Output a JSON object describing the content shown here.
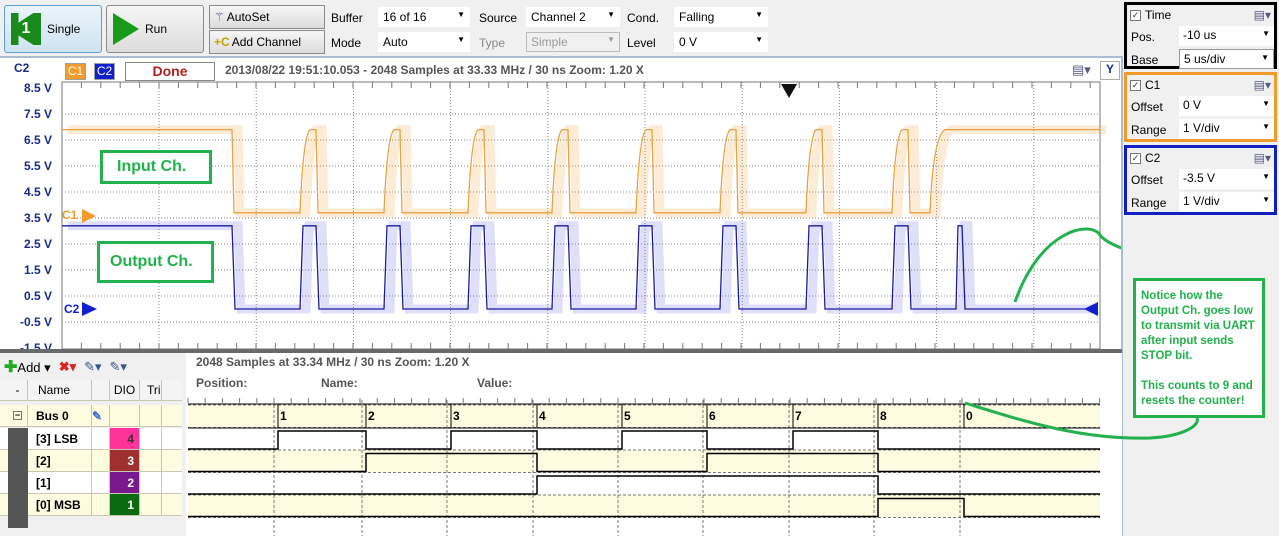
{
  "toolbar": {
    "single_label": "Single",
    "run_label": "Run",
    "autoset_label": "AutoSet",
    "add_channel_label": "Add Channel",
    "buffer_label": "Buffer",
    "buffer_value": "16 of 16",
    "mode_label": "Mode",
    "mode_value": "Auto",
    "source_label": "Source",
    "source_value": "Channel 2",
    "type_label": "Type",
    "type_value": "Simple",
    "cond_label": "Cond.",
    "cond_value": "Falling",
    "level_label": "Level",
    "level_value": "0 V"
  },
  "scope": {
    "active_channel": "C2",
    "badge_c1": "C1",
    "badge_c2": "C2",
    "status": "Done",
    "info": "2013/08/22  19:51:10.053 - 2048 Samples at 33.33 MHz / 30 ns Zoom: 1.20 X",
    "y_button": "Y",
    "y_labels": [
      "8.5 V",
      "7.5 V",
      "6.5 V",
      "5.5 V",
      "4.5 V",
      "3.5 V",
      "2.5 V",
      "1.5 V",
      "0.5 V",
      "-0.5 V",
      "-1.5 V"
    ],
    "c1_marker": "C1",
    "c2_marker": "C2",
    "colors": {
      "c1": "#f0a030",
      "c2": "#1a1aa0",
      "annotation": "#22b14c"
    }
  },
  "annotations": {
    "input": "Input Ch.",
    "output": "Output Ch.",
    "note1": "Notice how the Output Ch. goes low to transmit via UART after input sends STOP bit.",
    "note2": "This counts to 9 and resets the counter!"
  },
  "panels": {
    "time": {
      "title": "Time",
      "pos_label": "Pos.",
      "pos_value": "-10 us",
      "base_label": "Base",
      "base_value": "5 us/div"
    },
    "c1": {
      "title": "C1",
      "offset_label": "Offset",
      "offset_value": "0 V",
      "range_label": "Range",
      "range_value": "1 V/div"
    },
    "c2": {
      "title": "C2",
      "offset_label": "Offset",
      "offset_value": "-3.5 V",
      "range_label": "Range",
      "range_value": "1 V/div"
    }
  },
  "logic": {
    "add_label": "Add",
    "columns": {
      "minus": "-",
      "name": "Name",
      "dio": "DIO",
      "trigger": "Tri"
    },
    "bus": {
      "name": "Bus 0"
    },
    "signals": [
      {
        "name": "[3] LSB",
        "dio": "4",
        "color": "#ff3399"
      },
      {
        "name": "[2]",
        "dio": "3",
        "color": "#a03030"
      },
      {
        "name": "[1]",
        "dio": "2",
        "color": "#7a1890"
      },
      {
        "name": "[0] MSB",
        "dio": "1",
        "color": "#0a6a10"
      }
    ],
    "info": "2048 Samples at 33.34 MHz / 30 ns Zoom: 1.20 X",
    "position_label": "Position:",
    "name_label": "Name:",
    "value_label": "Value:",
    "bus_values": [
      "1",
      "2",
      "3",
      "4",
      "5",
      "6",
      "7",
      "8",
      "0"
    ]
  }
}
